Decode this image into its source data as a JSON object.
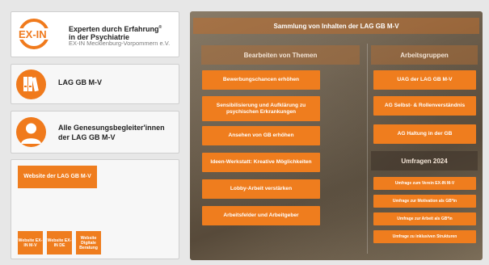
{
  "logo": {
    "mark_text": "EX-IN",
    "line1": "Experten durch Erfahrung",
    "line1b": "in der Psychiatrie",
    "line2": "EX-IN Mecklenburg-Vorpommern e.V.",
    "registered": "®"
  },
  "lag_card": {
    "label": "LAG GB M-V",
    "icon": "binders-icon"
  },
  "gen_card": {
    "label": "Alle Genesungsbegleiter'innen der LAG GB M-V",
    "icon": "user-icon"
  },
  "website_card": {
    "main_button": "Website der LAG GB M-V",
    "small_buttons": [
      "Website EX-IN M-V",
      "Website EX-IN DE",
      "Website Digitale Beratung"
    ]
  },
  "panel": {
    "title": "Sammlung von Inhalten der LAG GB M-V",
    "themes_header": "Bearbeiten von Themen",
    "themes": [
      "Bewerbungschancen erhöhen",
      "Sensibilisierung und Aufklärung zu psychischen Erkrankungen",
      "Ansehen von GB erhöhen",
      "Ideen-Werkstatt: Kreative Möglichkeiten",
      "Lobby-Arbeit verstärken",
      "Arbeitsfelder und Arbeitgeber"
    ],
    "groups_header": "Arbeitsgruppen",
    "groups": [
      "UAG der LAG GB M-V",
      "AG Selbst- & Rollenverständnis",
      "AG Haltung in der GB"
    ],
    "surveys_header": "Umfragen 2024",
    "surveys": [
      "Umfrage zum Verein EX-IN M-V",
      "Umfrage zur Motivation als GB*in",
      "Umfrage zur Arbeit als GB*in",
      "Umfrage zu inklusiven Strukturen"
    ]
  },
  "colors": {
    "accent": "#ef7d1e",
    "page_bg": "#e7e7e7"
  }
}
